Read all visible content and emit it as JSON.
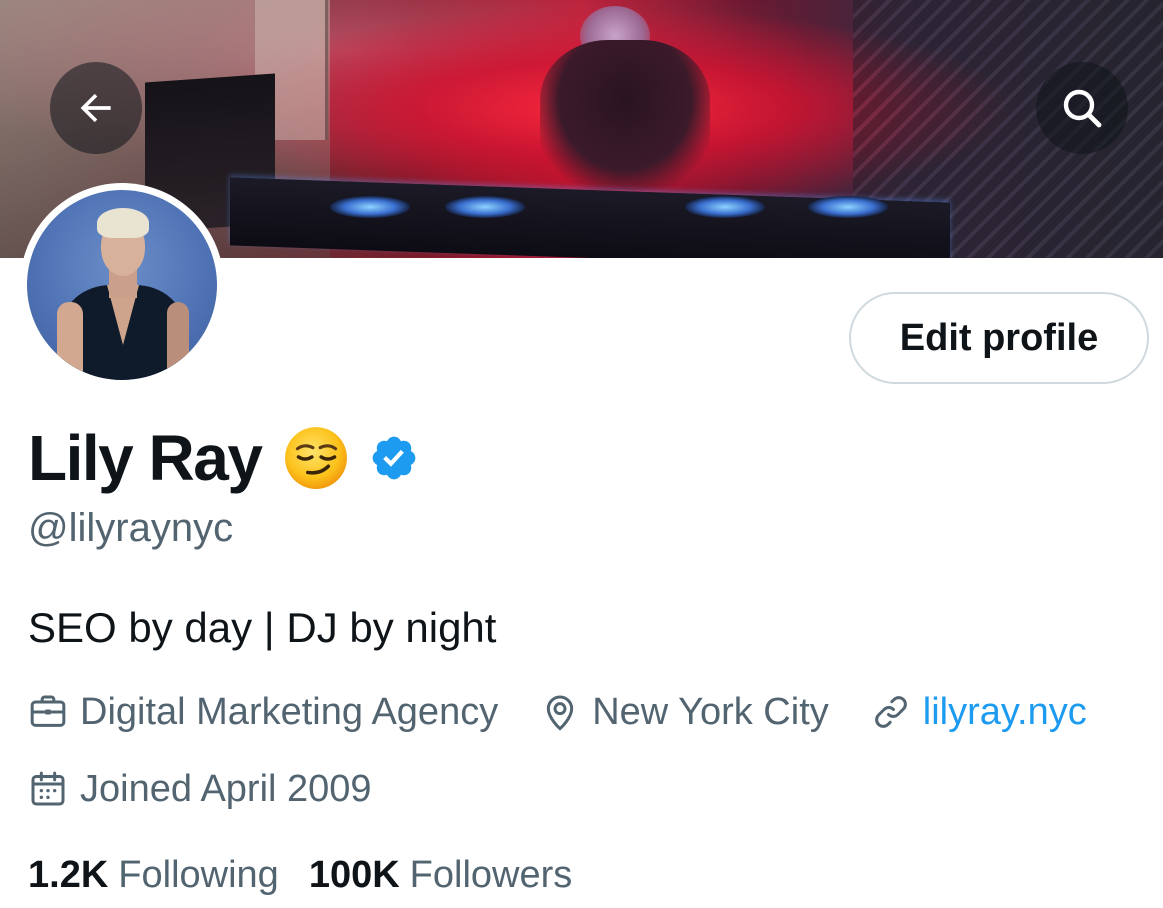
{
  "header": {
    "back_icon": "arrow-left-icon",
    "search_icon": "search-icon"
  },
  "profile": {
    "display_name": "Lily Ray",
    "name_emoji": "smirking-face-emoji",
    "verified": true,
    "verified_color": "#1d9bf0",
    "handle": "@lilyraynyc",
    "bio": "SEO by day | DJ by night",
    "edit_button_label": "Edit profile",
    "meta": {
      "category": "Digital Marketing Agency",
      "location": "New York City",
      "website": "lilyray.nyc",
      "joined": "Joined April 2009"
    },
    "stats": {
      "following_count": "1.2K",
      "following_label": "Following",
      "followers_count": "100K",
      "followers_label": "Followers"
    }
  },
  "colors": {
    "text_primary": "#0f1419",
    "text_secondary": "#536471",
    "link": "#1d9bf0",
    "border": "#cfd9de"
  }
}
